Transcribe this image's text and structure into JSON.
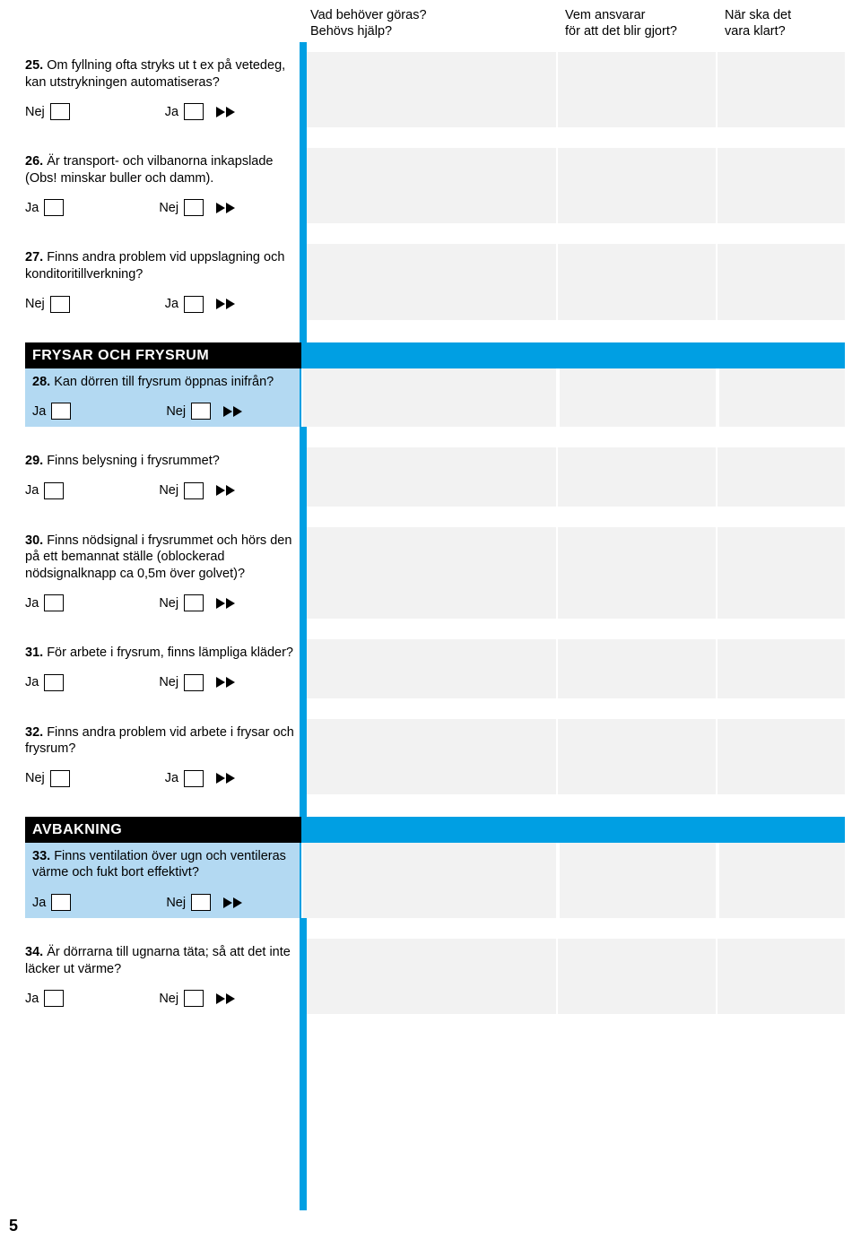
{
  "headers": {
    "col_a_line1": "Vad behöver göras?",
    "col_a_line2": "Behövs hjälp?",
    "col_b_line1": "Vem ansvarar",
    "col_b_line2": "för att det blir gjort?",
    "col_c_line1": "När ska det",
    "col_c_line2": "vara klart?"
  },
  "labels": {
    "yes": "Ja",
    "no": "Nej"
  },
  "sections": {
    "frysar": "FRYSAR OCH FRYSRUM",
    "avbakning": "AVBAKNING"
  },
  "items": {
    "q25": {
      "num": "25.",
      "text": " Om fyllning ofta stryks ut t ex på vetedeg, kan utstrykningen automatise­ras?"
    },
    "q26": {
      "num": "26.",
      "text": " Är transport- och vilbanorna inkapslade (Obs! minskar buller och damm)."
    },
    "q27": {
      "num": "27.",
      "text": " Finns andra problem vid uppslag­ning och konditoritillverkning?"
    },
    "q28": {
      "num": "28.",
      "text": " Kan dörren till frysrum öppnas inifrån?"
    },
    "q29": {
      "num": "29.",
      "text": " Finns belysning i frysrummet?"
    },
    "q30": {
      "num": "30.",
      "text": " Finns nödsignal i frysrummet och hörs den på ett bemannat ställe (oblockerad nödsignalknapp ca 0,5m över golvet)?"
    },
    "q31": {
      "num": "31.",
      "text": " För arbete i frysrum, finns lämpli­ga kläder?"
    },
    "q32": {
      "num": "32.",
      "text": " Finns andra problem vid arbete i frysar och frysrum?"
    },
    "q33": {
      "num": "33.",
      "text": " Finns ventilation över ugn och ven­tileras värme och fukt bort effektivt?"
    },
    "q34": {
      "num": "34.",
      "text": " Är dörrarna till ugnarna täta; så att det inte läcker ut värme?"
    }
  },
  "page_number": "5"
}
